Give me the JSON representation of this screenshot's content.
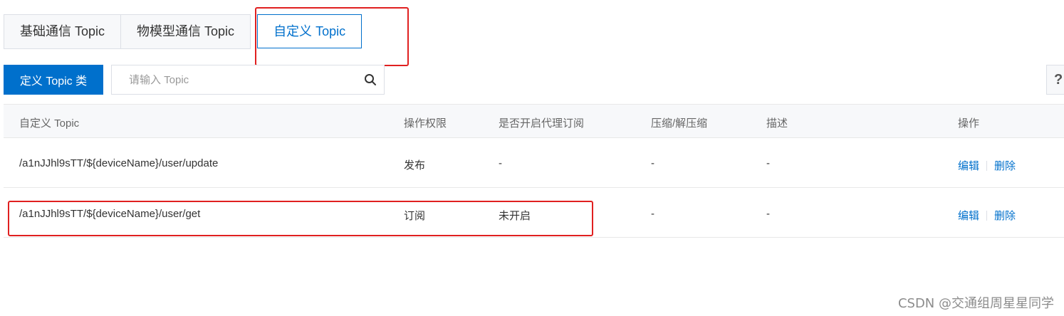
{
  "tabs": [
    {
      "label": "基础通信 Topic"
    },
    {
      "label": "物模型通信 Topic"
    },
    {
      "label": "自定义 Topic"
    }
  ],
  "toolbar": {
    "define_button": "定义 Topic 类",
    "search_placeholder": "请输入 Topic",
    "help": "?"
  },
  "table": {
    "headers": [
      "自定义 Topic",
      "操作权限",
      "是否开启代理订阅",
      "压缩/解压缩",
      "描述",
      "操作"
    ],
    "rows": [
      {
        "topic": "/a1nJJhl9sTT/${deviceName}/user/update",
        "permission": "发布",
        "proxy": "-",
        "compress": "-",
        "desc": "-",
        "edit": "编辑",
        "delete": "删除"
      },
      {
        "topic": "/a1nJJhl9sTT/${deviceName}/user/get",
        "permission": "订阅",
        "proxy": "未开启",
        "compress": "-",
        "desc": "-",
        "edit": "编辑",
        "delete": "删除"
      }
    ]
  },
  "watermark": "CSDN @交通组周星星同学",
  "colors": {
    "accent": "#0070cc",
    "highlight": "#e02020"
  }
}
